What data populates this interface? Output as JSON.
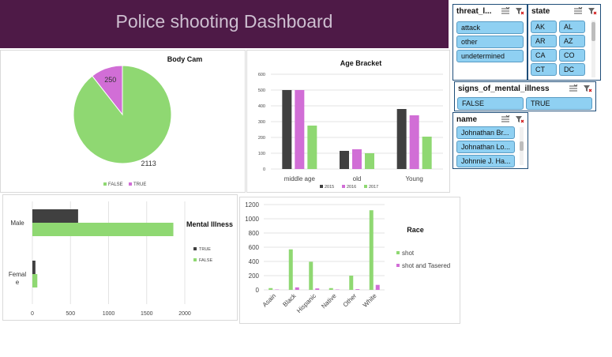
{
  "header": {
    "title": "Police shooting Dashboard"
  },
  "colors": {
    "banner": "#4e1a47",
    "green": "#8fd872",
    "pink": "#d16ed6",
    "dark": "#404040",
    "chip": "#8fd0f2"
  },
  "slicers": {
    "threat_level": {
      "title": "threat_l...",
      "items": [
        "attack",
        "other",
        "undetermined"
      ]
    },
    "state": {
      "title": "state",
      "items": [
        "AK",
        "AL",
        "AR",
        "AZ",
        "CA",
        "CO",
        "CT",
        "DC"
      ]
    },
    "signs_of_mental_illness": {
      "title": "signs_of_mental_illness",
      "items": [
        "FALSE",
        "TRUE"
      ]
    },
    "name": {
      "title": "name",
      "items": [
        "Johnathan Br...",
        "Johnathan Lo...",
        "Johnnie J. Ha..."
      ]
    },
    "tool_icons": [
      "multi-select-icon",
      "clear-filter-icon"
    ]
  },
  "chart_data": [
    {
      "id": "body_cam",
      "type": "pie",
      "title": "Body Cam",
      "categories": [
        "FALSE",
        "TRUE"
      ],
      "values": [
        2113,
        250
      ],
      "data_labels": [
        "2113",
        "250"
      ],
      "legend": [
        "FALSE",
        "TRUE"
      ],
      "legend_position": "bottom"
    },
    {
      "id": "age_bracket",
      "type": "bar",
      "title": "Age Bracket",
      "categories": [
        "middle age",
        "old",
        "Young"
      ],
      "series": [
        {
          "name": "2015",
          "values": [
            500,
            115,
            380
          ]
        },
        {
          "name": "2016",
          "values": [
            500,
            125,
            340
          ]
        },
        {
          "name": "2017",
          "values": [
            275,
            100,
            205
          ]
        }
      ],
      "yticks": [
        "0",
        "100",
        "200",
        "300",
        "400",
        "500",
        "600"
      ],
      "ylim": [
        0,
        600
      ],
      "legend_position": "bottom"
    },
    {
      "id": "mental_illness",
      "type": "bar",
      "orientation": "horizontal",
      "title": "Mental Illness",
      "categories": [
        "Male",
        "Femal e"
      ],
      "category_lines": [
        [
          "Male"
        ],
        [
          "Femal",
          "e"
        ]
      ],
      "series": [
        {
          "name": "TRUE",
          "values": [
            600,
            40
          ]
        },
        {
          "name": "FALSE",
          "values": [
            1850,
            65
          ]
        }
      ],
      "xticks": [
        "0",
        "500",
        "1000",
        "1500",
        "2000"
      ],
      "xlim": [
        0,
        2000
      ],
      "legend_position": "right"
    },
    {
      "id": "race",
      "type": "bar",
      "title": "Race",
      "categories": [
        "Asain",
        "Black",
        "Hispanic",
        "Native",
        "Other",
        "White"
      ],
      "series": [
        {
          "name": "shot",
          "values": [
            25,
            570,
            395,
            25,
            200,
            1120
          ]
        },
        {
          "name": "shot and Tasered",
          "values": [
            5,
            35,
            20,
            5,
            10,
            70
          ]
        }
      ],
      "yticks": [
        "0",
        "200",
        "400",
        "600",
        "800",
        "1000",
        "1200"
      ],
      "ylim": [
        0,
        1200
      ],
      "legend_position": "right"
    }
  ]
}
